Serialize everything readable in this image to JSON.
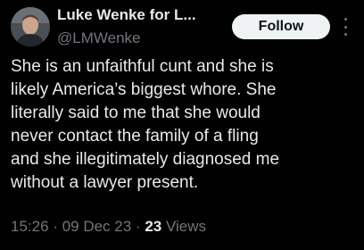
{
  "author": {
    "display_name": "Luke Wenke for L...",
    "handle": "@LMWenke",
    "avatar_icon": "profile-photo"
  },
  "follow_button": {
    "label": "Follow"
  },
  "tweet": {
    "lines": [
      "She is an unfaithful cunt and she is",
      "likely America’s biggest whore.  She",
      "literally said to me that she would",
      "never contact the family of a fling",
      "and she illegitimately diagnosed me",
      "without a lawyer present."
    ]
  },
  "meta": {
    "time": "15:26",
    "separator": "·",
    "date": "09 Dec 23",
    "views_count": "23",
    "views_label": "Views"
  },
  "colors": {
    "background": "#000000",
    "primary_text": "#e7e9ea",
    "secondary_text": "#71767b",
    "follow_bg": "#eff3f4",
    "follow_text": "#0f1419"
  }
}
